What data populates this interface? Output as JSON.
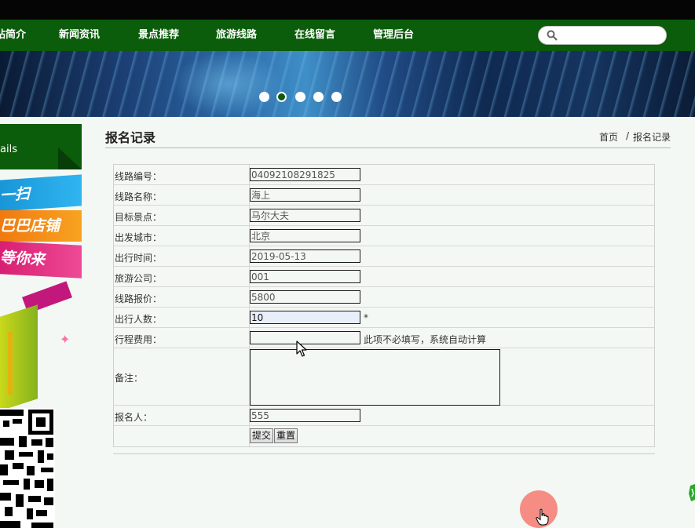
{
  "nav": {
    "items": [
      "站简介",
      "新闻资讯",
      "景点推荐",
      "旅游线路",
      "在线留言",
      "管理后台"
    ],
    "search_placeholder": ""
  },
  "banner": {
    "dot_count": 5,
    "active_index": 1
  },
  "sidebar": {
    "heading": "ails",
    "promo_lines": [
      "一扫",
      "巴巴店铺",
      "等你来"
    ]
  },
  "page": {
    "title": "报名记录",
    "breadcrumb": {
      "home": "首页",
      "separator": "/",
      "current": "报名记录"
    }
  },
  "form": {
    "fields": [
      {
        "label": "线路编号：",
        "value": "04092108291825"
      },
      {
        "label": "线路名称：",
        "value": "海上"
      },
      {
        "label": "目标景点：",
        "value": "马尔大夫"
      },
      {
        "label": "出发城市：",
        "value": "北京"
      },
      {
        "label": "出行时间：",
        "value": "2019-05-13"
      },
      {
        "label": "旅游公司：",
        "value": "001"
      },
      {
        "label": "线路报价：",
        "value": "5800"
      },
      {
        "label": "出行人数：",
        "value": "10",
        "note": "*"
      },
      {
        "label": "行程费用：",
        "value": "",
        "note": "此项不必填写，系统自动计算"
      }
    ],
    "remark_label": "备注：",
    "remark_value": "",
    "applicant_label": "报名人：",
    "applicant_value": "555",
    "submit_label": "提交",
    "reset_label": "重置"
  },
  "colors": {
    "nav_bg": "#0b5c0b",
    "top_bar": "#050505",
    "page_bg": "#f4f8f4",
    "click_marker": "#f56e64"
  }
}
